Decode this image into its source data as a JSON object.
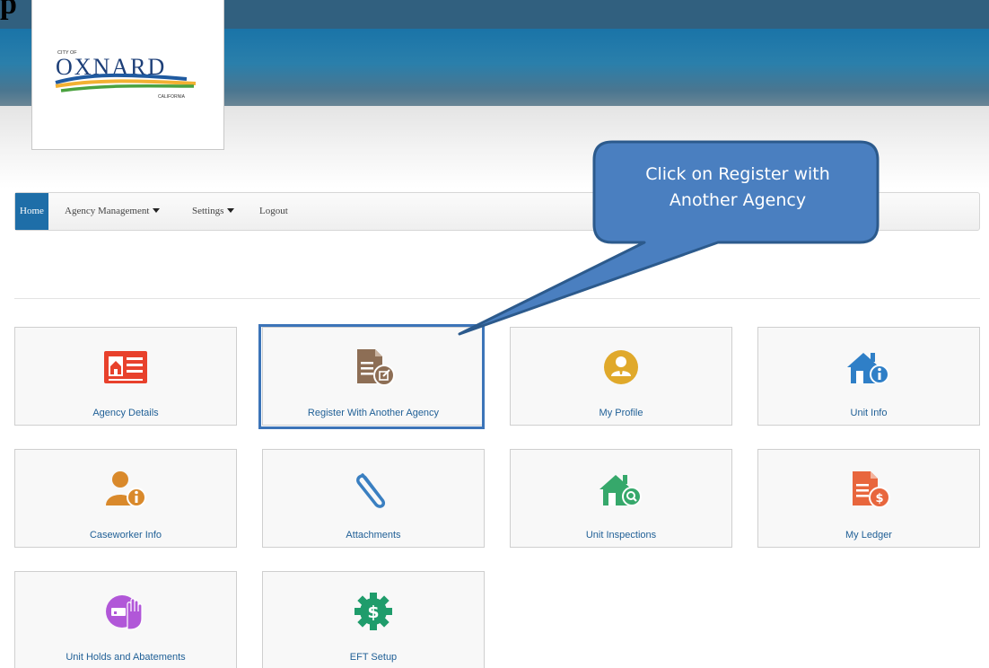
{
  "document": {
    "heading": "p"
  },
  "logo": {
    "city_of": "CITY OF",
    "name": "OXNARD",
    "state": "CALIFORNIA"
  },
  "nav": {
    "home": "Home",
    "agency_management": "Agency Management",
    "settings": "Settings",
    "logout": "Logout"
  },
  "tiles": [
    {
      "label": "Agency Details",
      "icon": "newspaper-icon",
      "color": "#e8412c"
    },
    {
      "label": "Register With Another Agency",
      "icon": "document-edit-icon",
      "color": "#8d6e55"
    },
    {
      "label": "My Profile",
      "icon": "user-circle-icon",
      "color": "#e0a92b"
    },
    {
      "label": "Unit Info",
      "icon": "house-info-icon",
      "color": "#2f7fc7"
    },
    {
      "label": "Caseworker Info",
      "icon": "person-info-icon",
      "color": "#d9892b"
    },
    {
      "label": "Attachments",
      "icon": "paperclip-icon",
      "color": "#3a7fc1"
    },
    {
      "label": "Unit Inspections",
      "icon": "house-search-icon",
      "color": "#36a86b"
    },
    {
      "label": "My Ledger",
      "icon": "document-dollar-icon",
      "color": "#e8663d"
    },
    {
      "label": "Unit Holds and Abatements",
      "icon": "hand-stop-icon",
      "color": "#b157d8"
    },
    {
      "label": "EFT Setup",
      "icon": "gear-dollar-icon",
      "color": "#1f9c6b"
    }
  ],
  "callout": {
    "line1": "Click on Register with",
    "line2": "Another Agency"
  }
}
